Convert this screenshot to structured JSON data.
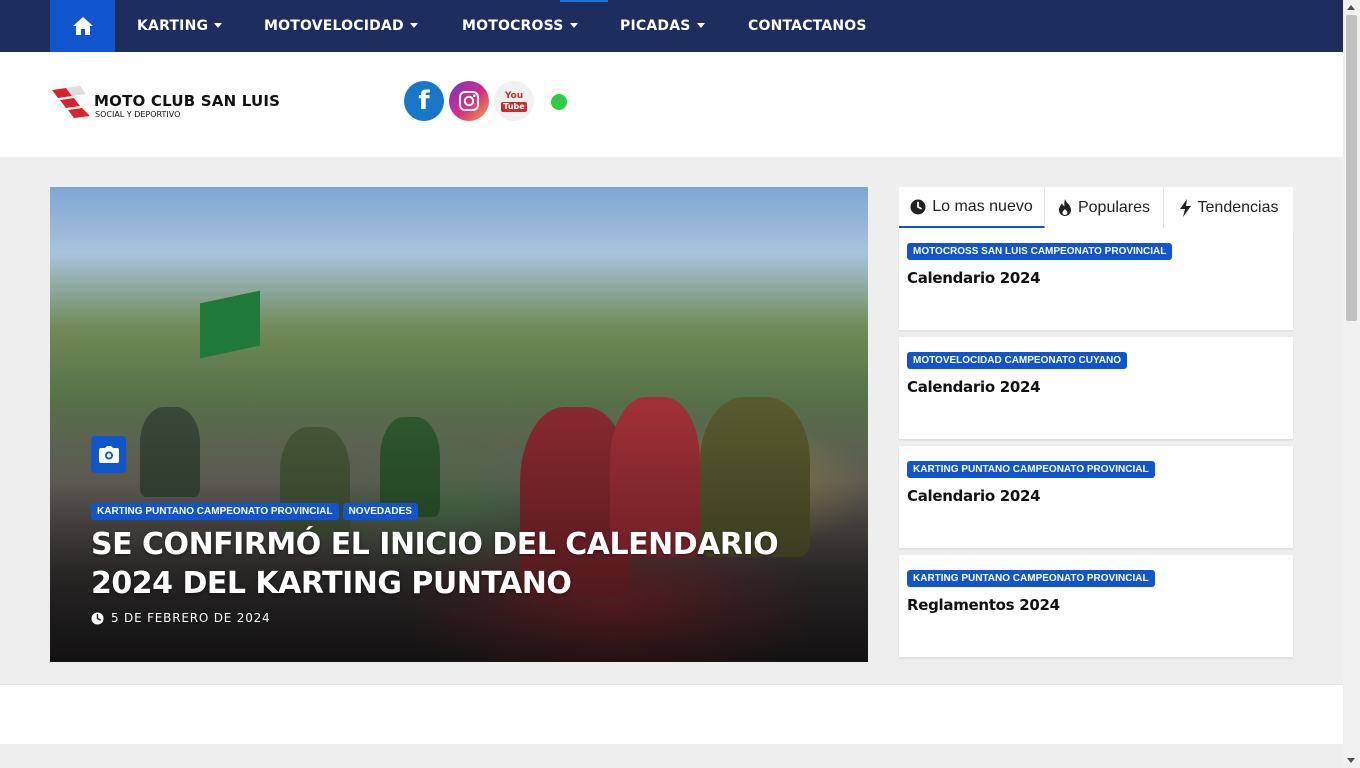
{
  "nav": {
    "home_icon": "home-icon",
    "items": [
      {
        "label": "KARTING",
        "has_dropdown": true
      },
      {
        "label": "MOTOVELOCIDAD",
        "has_dropdown": true
      },
      {
        "label": "MOTOCROSS",
        "has_dropdown": true
      },
      {
        "label": "PICADAS",
        "has_dropdown": true
      },
      {
        "label": "CONTACTANOS",
        "has_dropdown": false
      }
    ]
  },
  "header": {
    "logo_title": "MOTO CLUB SAN LUIS",
    "logo_subtitle": "SOCIAL Y DEPORTIVO",
    "social": [
      {
        "name": "facebook-icon",
        "glyph": "f"
      },
      {
        "name": "instagram-icon"
      },
      {
        "name": "youtube-icon",
        "text_top": "You",
        "text_bottom": "Tube"
      }
    ],
    "status_color": "#2ecc40"
  },
  "hero": {
    "icon": "camera-icon",
    "categories": [
      "KARTING PUNTANO CAMPEONATO PROVINCIAL",
      "NOVEDADES"
    ],
    "title": "SE CONFIRMÓ EL INICIO DEL CALENDARIO 2024 DEL KARTING PUNTANO",
    "date": "5 DE FEBRERO DE 2024"
  },
  "sidebar": {
    "tabs": [
      {
        "label": "Lo mas nuevo",
        "icon": "clock-icon",
        "active": true
      },
      {
        "label": "Populares",
        "icon": "fire-icon",
        "active": false
      },
      {
        "label": "Tendencias",
        "icon": "bolt-icon",
        "active": false
      }
    ],
    "posts": [
      {
        "category": "MOTOCROSS SAN LUIS CAMPEONATO PROVINCIAL",
        "title": "Calendario 2024"
      },
      {
        "category": "MOTOVELOCIDAD CAMPEONATO CUYANO",
        "title": "Calendario 2024"
      },
      {
        "category": "KARTING PUNTANO CAMPEONATO PROVINCIAL",
        "title": "Calendario 2024"
      },
      {
        "category": "KARTING PUNTANO CAMPEONATO PROVINCIAL",
        "title": "Reglamentos 2024"
      }
    ]
  },
  "colors": {
    "nav_bg": "#1c2d5e",
    "accent": "#1155cc",
    "page_bg": "#eeeeee"
  }
}
